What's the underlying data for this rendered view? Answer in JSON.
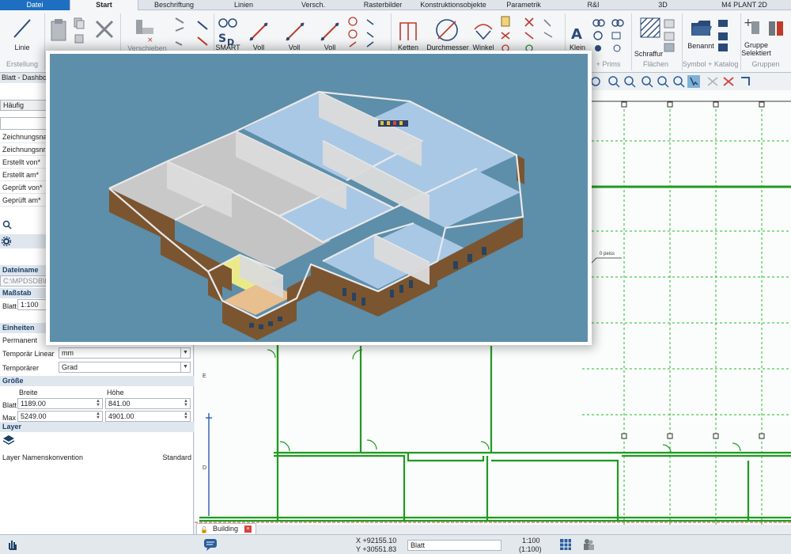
{
  "ribbon_tabs": [
    "Datei",
    "Start",
    "Beschriftung",
    "Linien",
    "Versch.",
    "Rasterbilder",
    "Konstruktionsobjekte",
    "Parametrik",
    "R&I",
    "3D",
    "M4 PLANT 2D"
  ],
  "ribbon": {
    "linie": "Linie",
    "verschieben": "Verschieben",
    "smart": "SMART",
    "voll1": "Voll",
    "voll2": "Voll",
    "voll3": "Voll",
    "ketten": "Ketten",
    "durchmesser": "Durchmesser",
    "winkel": "Winkel",
    "klein": "Klein",
    "schraffur": "Schraffur",
    "benannt": "Benannt",
    "gruppe": "Gruppe",
    "selektiert": "Selektiert"
  },
  "ribbon_groups": {
    "erstellung": "Erstellung",
    "prims": "+ Prims",
    "flaechen": "Flächen",
    "symbol_katalog": "Symbol + Katalog",
    "gruppen": "Gruppen"
  },
  "panel": {
    "title": "Blatt - Dashboard",
    "haeufig": "Häufig",
    "meta_labels": [
      "Zeichnungsname",
      "Zeichnungsnr.*",
      "Erstellt von*",
      "Erstellt am*",
      "Geprüft von*",
      "Geprüft am*"
    ],
    "dateiname_header": "Dateiname",
    "dateiname_value": "C:\\MPDSDB\\MA",
    "massstab_header": "Maßstab",
    "blatt_label": "Blatt",
    "blatt_scale": "1:100",
    "einheiten_header": "Einheiten",
    "permanent_label": "Permanent",
    "temp_linear_label": "Temporär Linear",
    "temp_linear_value": "mm",
    "temp_winkel_label": "Temporärer Winkel",
    "temp_winkel_value": "Grad",
    "groesse_header": "Größe",
    "breite_label": "Breite",
    "hoehe_label": "Höhe",
    "blatt_row_label": "Blatt",
    "blatt_breite": "1189.00",
    "blatt_hoehe": "841.00",
    "max_row_label": "Max",
    "max_breite": "5249.00",
    "max_hoehe": "4901.00",
    "layer_header": "Layer",
    "layer_namenskonvention": "Layer Namenskonvention",
    "layer_standard": "Standard"
  },
  "drawing": {
    "grid_label_e": "E",
    "grid_label_d": "D",
    "annotation": "0 peiss",
    "sheet_tab": "Building"
  },
  "status": {
    "x_coord": "X +92155.10",
    "y_coord": "Y +30551.83",
    "layer_value": "Blatt",
    "scale1": "1:100",
    "scale2": "(1:100)"
  },
  "colors": {
    "file_tab": "#1e6fbf",
    "section_header": "#dfe6ee",
    "grid_line": "#22bb22",
    "wall_line": "#1f9b1f",
    "render_bg": "#5d8eaa",
    "brick": "#7a5530"
  }
}
